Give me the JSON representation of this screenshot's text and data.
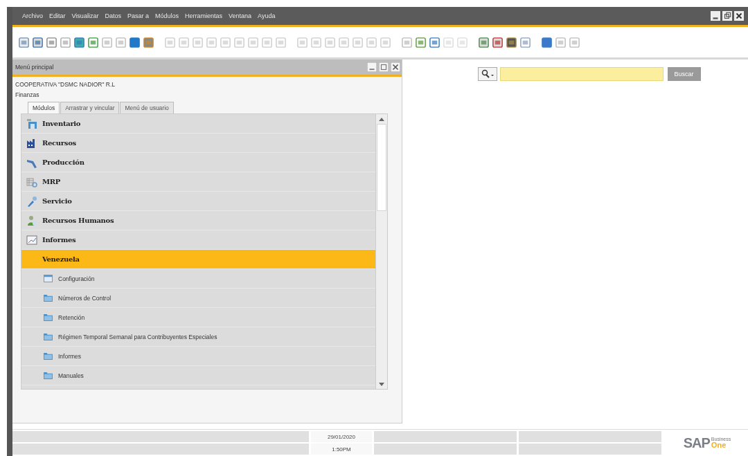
{
  "menu_bar": [
    "Archivo",
    "Editar",
    "Visualizar",
    "Datos",
    "Pasar a",
    "Módulos",
    "Herramientas",
    "Ventana",
    "Ayuda"
  ],
  "search": {
    "button": "Buscar"
  },
  "main_menu": {
    "title": "Menú principal",
    "company": "COOPERATIVA \"DSMC NADIOR\" R.L",
    "user": "Finanzas",
    "tabs": [
      {
        "label": "Módulos",
        "selected": true
      },
      {
        "label": "Arrastrar y vincular",
        "selected": false
      },
      {
        "label": "Menú de usuario",
        "selected": false
      }
    ],
    "items": [
      {
        "label": "Inventario",
        "kind": "inventory",
        "selected": false
      },
      {
        "label": "Recursos",
        "kind": "factory",
        "selected": false
      },
      {
        "label": "Producción",
        "kind": "production",
        "selected": false
      },
      {
        "label": "MRP",
        "kind": "mrp",
        "selected": false
      },
      {
        "label": "Servicio",
        "kind": "service",
        "selected": false
      },
      {
        "label": "Recursos Humanos",
        "kind": "people",
        "selected": false
      },
      {
        "label": "Informes",
        "kind": "report",
        "selected": false
      },
      {
        "label": "Venezuela",
        "kind": "none",
        "selected": true,
        "children": [
          {
            "label": "Configuración",
            "kind": "window"
          },
          {
            "label": "Números de Control",
            "kind": "folder"
          },
          {
            "label": "Retención",
            "kind": "folder"
          },
          {
            "label": "Régimen Temporal Semanal para Contribuyentes Especiales",
            "kind": "folder"
          },
          {
            "label": "Informes",
            "kind": "folder"
          },
          {
            "label": "Manuales",
            "kind": "folder"
          }
        ]
      }
    ]
  },
  "status_bar": {
    "date": "29/01/2020",
    "time": "1:50PM"
  },
  "logo": {
    "brand": "SAP",
    "line_1": "Business",
    "line_2": "One"
  }
}
